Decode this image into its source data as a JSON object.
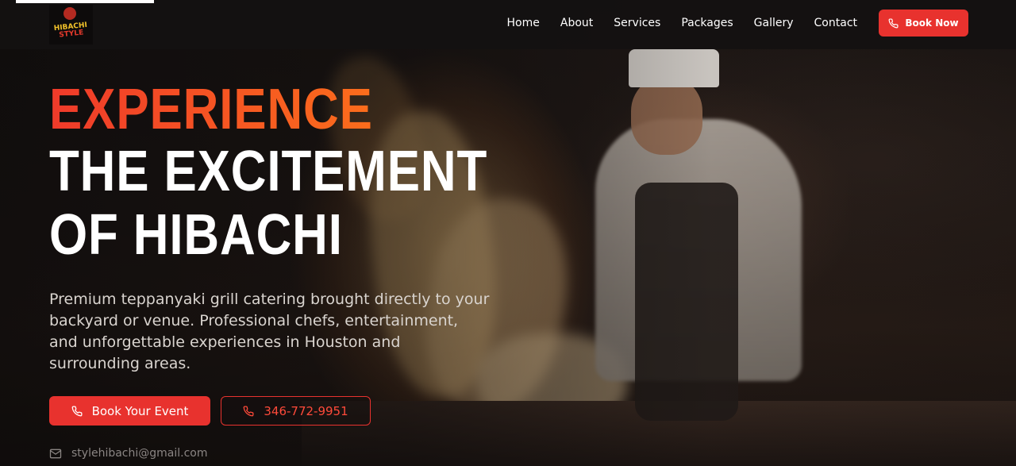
{
  "brand": {
    "logo_line1": "HIBACHI",
    "logo_line2": "STYLE"
  },
  "nav": {
    "items": [
      "Home",
      "About",
      "Services",
      "Packages",
      "Gallery",
      "Contact"
    ],
    "book_now": "Book Now"
  },
  "hero": {
    "title_line1": "EXPERIENCE",
    "title_line2": "THE EXCITEMENT",
    "title_line3": "OF HIBACHI",
    "description": "Premium teppanyaki grill catering brought directly to your backyard or venue. Professional chefs, entertainment, and unforgettable experiences in Houston and surrounding areas.",
    "cta_primary": "Book Your Event",
    "cta_phone": "346-772-9951",
    "email": "stylehibachi@gmail.com"
  },
  "colors": {
    "accent": "#e8322e",
    "title_gradient_start": "#ef3a2a",
    "title_gradient_end": "#ff7f17"
  },
  "icons": {
    "phone": "phone-icon",
    "mail": "mail-icon"
  }
}
